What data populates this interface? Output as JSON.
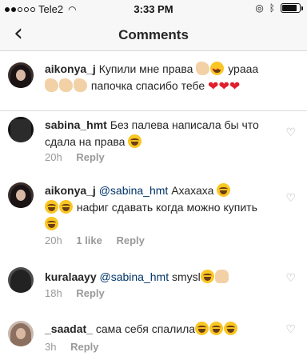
{
  "status_bar": {
    "carrier": "Tele2",
    "time": "3:33 PM",
    "signal_bars_filled": 2,
    "signal_bars_total": 5,
    "battery_level": 0.85
  },
  "header": {
    "title": "Comments",
    "back_icon": "chevron-left-icon"
  },
  "caption": {
    "username": "aikonya_j",
    "text_1": "Купили мне права",
    "text_2": "урааа",
    "text_3": "папочка спасибо тебе"
  },
  "comments": [
    {
      "username": "sabina_hmt",
      "text": "Без палева написала бы что сдала на права",
      "time": "20h",
      "reply": "Reply"
    },
    {
      "username": "aikonya_j",
      "mention": "@sabina_hmt",
      "text_1": "Ахахаха",
      "text_2": "нафиг сдавать когда можно купить",
      "time": "20h",
      "likes": "1 like",
      "reply": "Reply"
    },
    {
      "username": "kuralaayy",
      "mention": "@sabina_hmt",
      "text": "smysl",
      "time": "18h",
      "reply": "Reply"
    },
    {
      "username": "_saadat_",
      "text": "сама себя спалила",
      "time": "3h",
      "reply": "Reply"
    }
  ],
  "colors": {
    "background": "#ffffff",
    "header_bg": "#f7f7f7",
    "text": "#262626",
    "meta": "#999999",
    "mention": "#003569",
    "heart": "#e0202e"
  }
}
